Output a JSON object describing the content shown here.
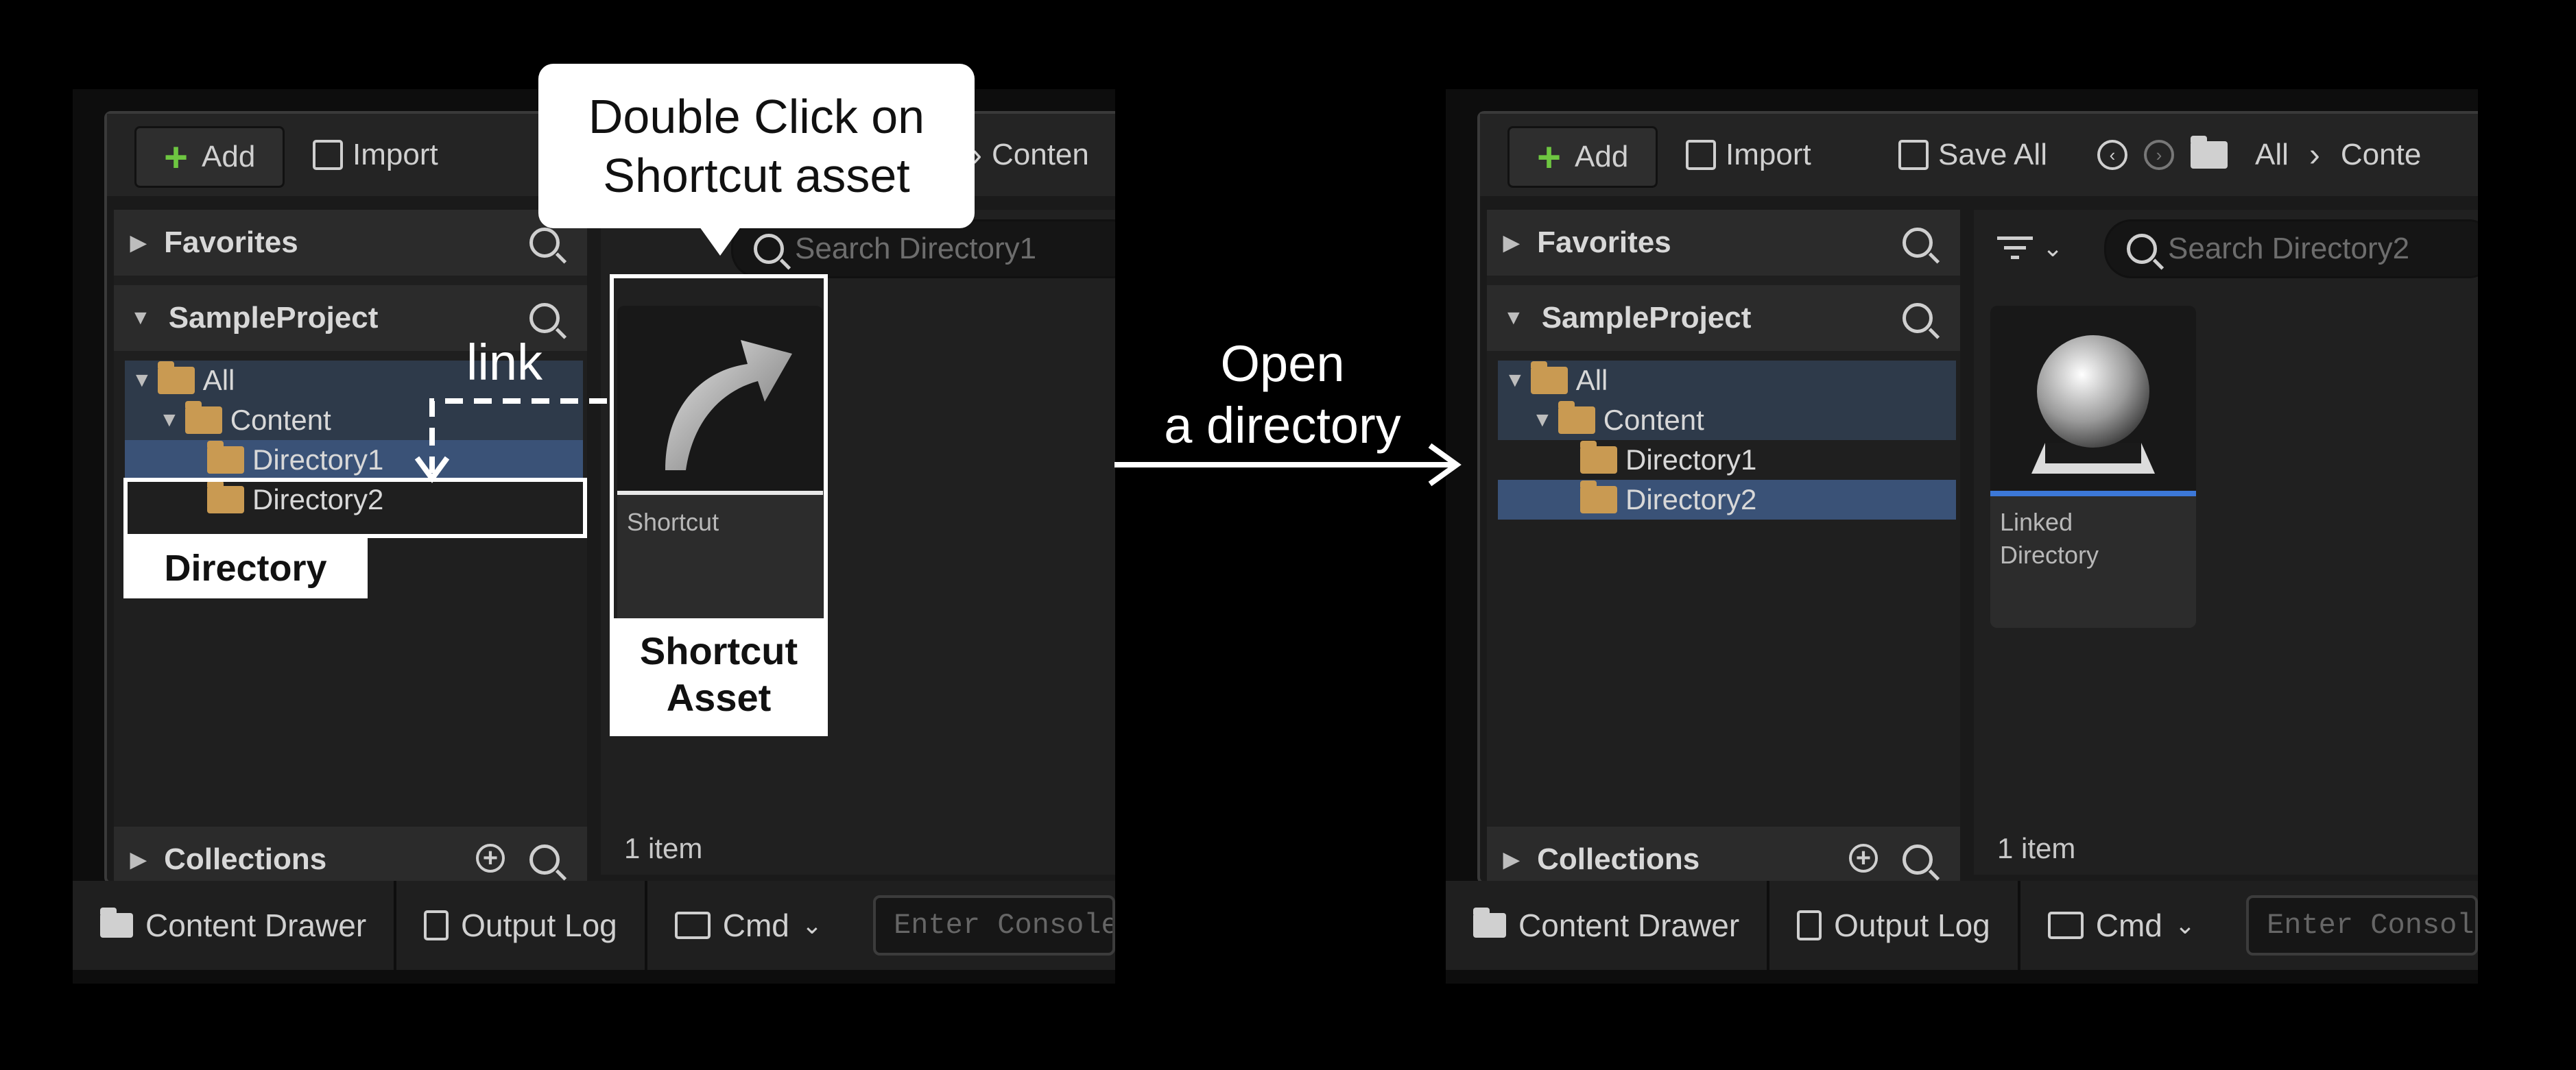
{
  "left_panel": {
    "toolbar": {
      "add": "Add",
      "import": "Import",
      "path_fragment": "Conten"
    },
    "sidebar": {
      "favorites": "Favorites",
      "project": "SampleProject",
      "tree": [
        "All",
        "Content",
        "Directory1",
        "Directory2"
      ],
      "collections": "Collections"
    },
    "content": {
      "search_placeholder": "Search Directory1",
      "tile_label": "Shortcut",
      "item_count": "1 item"
    }
  },
  "right_panel": {
    "toolbar": {
      "add": "Add",
      "import": "Import",
      "save_all": "Save All",
      "path_all": "All",
      "path_fragment": "Conte"
    },
    "sidebar": {
      "favorites": "Favorites",
      "project": "SampleProject",
      "tree": [
        "All",
        "Content",
        "Directory1",
        "Directory2"
      ],
      "collections": "Collections"
    },
    "content": {
      "search_placeholder": "Search Directory2",
      "tile_label_1": "Linked",
      "tile_label_2": "Directory",
      "item_count": "1 item"
    }
  },
  "status_bar": {
    "content_drawer": "Content Drawer",
    "output_log": "Output Log",
    "cmd": "Cmd",
    "console_placeholder": "Enter Console"
  },
  "annotations": {
    "callout_line1": "Double Click on",
    "callout_line2": "Shortcut asset",
    "link": "link",
    "directory": "Directory",
    "shortcut_asset_1": "Shortcut",
    "shortcut_asset_2": "Asset",
    "arrow_line1": "Open",
    "arrow_line2": "a directory"
  }
}
